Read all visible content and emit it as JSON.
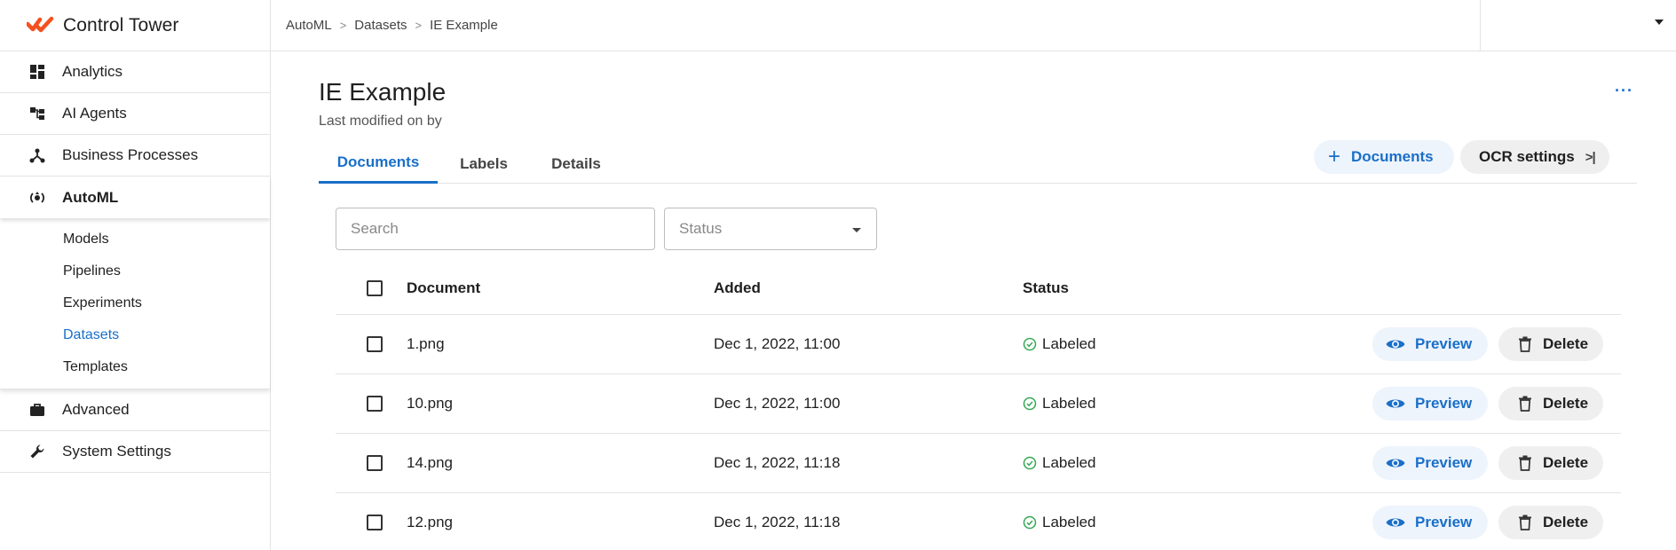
{
  "app": {
    "brand_name": "Control Tower",
    "brand_color": "#f4511e",
    "accent_color": "#1a6fc9",
    "success_color": "#34a853"
  },
  "sidebar": {
    "items": [
      {
        "label": "Analytics",
        "icon": "dashboard-icon"
      },
      {
        "label": "AI Agents",
        "icon": "hierarchy-icon"
      },
      {
        "label": "Business Processes",
        "icon": "network-icon"
      },
      {
        "label": "AutoML",
        "icon": "automl-icon"
      },
      {
        "label": "Advanced",
        "icon": "briefcase-icon"
      },
      {
        "label": "System Settings",
        "icon": "wrench-icon"
      }
    ],
    "automl_sub": [
      "Models",
      "Pipelines",
      "Experiments",
      "Datasets",
      "Templates"
    ]
  },
  "breadcrumbs": [
    "AutoML",
    "Datasets",
    "IE Example"
  ],
  "page": {
    "title": "IE Example",
    "subtitle": "Last modified on by",
    "more": "···"
  },
  "tabs": [
    "Documents",
    "Labels",
    "Details"
  ],
  "actions": {
    "add_documents": "Documents",
    "ocr_settings": "OCR settings"
  },
  "filters": {
    "search_placeholder": "Search",
    "status_placeholder": "Status"
  },
  "table": {
    "headers": {
      "document": "Document",
      "added": "Added",
      "status": "Status"
    },
    "rows": [
      {
        "document": "1.png",
        "added": "Dec 1, 2022, 11:00",
        "status": "Labeled"
      },
      {
        "document": "10.png",
        "added": "Dec 1, 2022, 11:00",
        "status": "Labeled"
      },
      {
        "document": "14.png",
        "added": "Dec 1, 2022, 11:18",
        "status": "Labeled"
      },
      {
        "document": "12.png",
        "added": "Dec 1, 2022, 11:18",
        "status": "Labeled"
      }
    ],
    "preview_label": "Preview",
    "delete_label": "Delete"
  }
}
